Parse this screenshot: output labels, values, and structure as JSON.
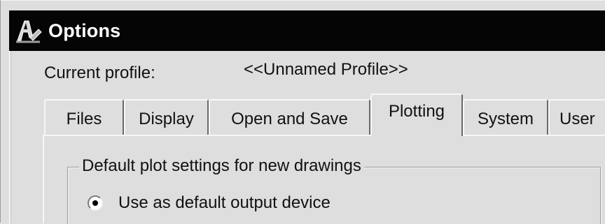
{
  "window": {
    "title": "Options",
    "icon": "autocad-app-icon"
  },
  "profile": {
    "label": "Current profile:",
    "value": "<<Unnamed Profile>>"
  },
  "tabs": [
    {
      "label": "Files",
      "active": false
    },
    {
      "label": "Display",
      "active": false
    },
    {
      "label": "Open and Save",
      "active": false
    },
    {
      "label": "Plotting",
      "active": true
    },
    {
      "label": "System",
      "active": false
    },
    {
      "label": "User",
      "active": false
    }
  ],
  "plotting": {
    "group_label": "Default plot settings for new drawings",
    "radio_label": "Use as default output device",
    "radio_selected": true
  }
}
